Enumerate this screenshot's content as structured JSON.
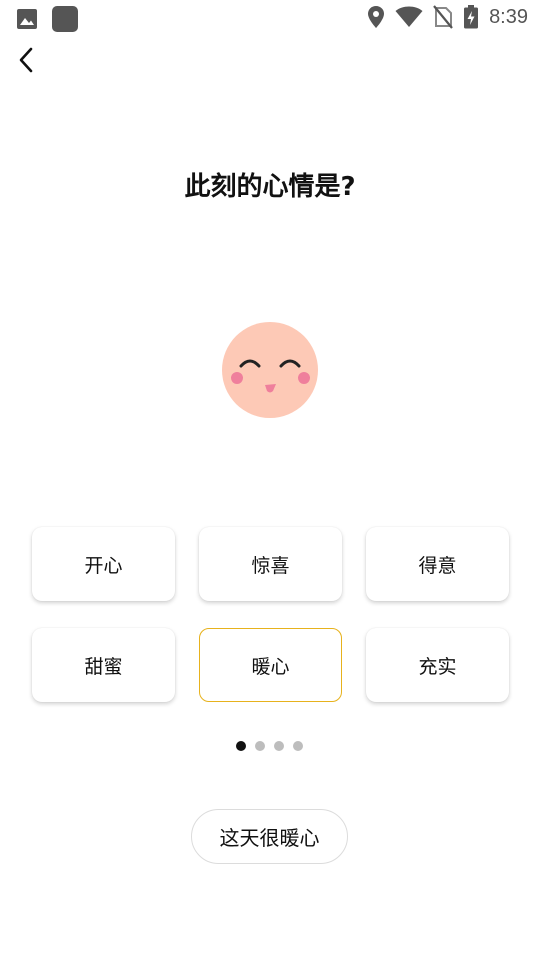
{
  "status_bar": {
    "time": "8:39",
    "icons": [
      "image-icon",
      "app-icon",
      "location-icon",
      "wifi-icon",
      "no-sim-icon",
      "battery-charging-icon"
    ]
  },
  "nav": {
    "back_icon": "chevron-left-icon"
  },
  "title": "此刻的心情是?",
  "face_icon": "smiling-face-icon",
  "moods": [
    {
      "label": "开心",
      "selected": false
    },
    {
      "label": "惊喜",
      "selected": false
    },
    {
      "label": "得意",
      "selected": false
    },
    {
      "label": "甜蜜",
      "selected": false
    },
    {
      "label": "暖心",
      "selected": true
    },
    {
      "label": "充实",
      "selected": false
    }
  ],
  "pager": {
    "count": 4,
    "active": 0
  },
  "confirm_label": "这天很暖心",
  "colors": {
    "selected_border": "#e7b21d",
    "face": "#fdc9b6",
    "blush": "#ef7f9c",
    "dot_active": "#111111",
    "dot_inactive": "#bdbdbd"
  }
}
